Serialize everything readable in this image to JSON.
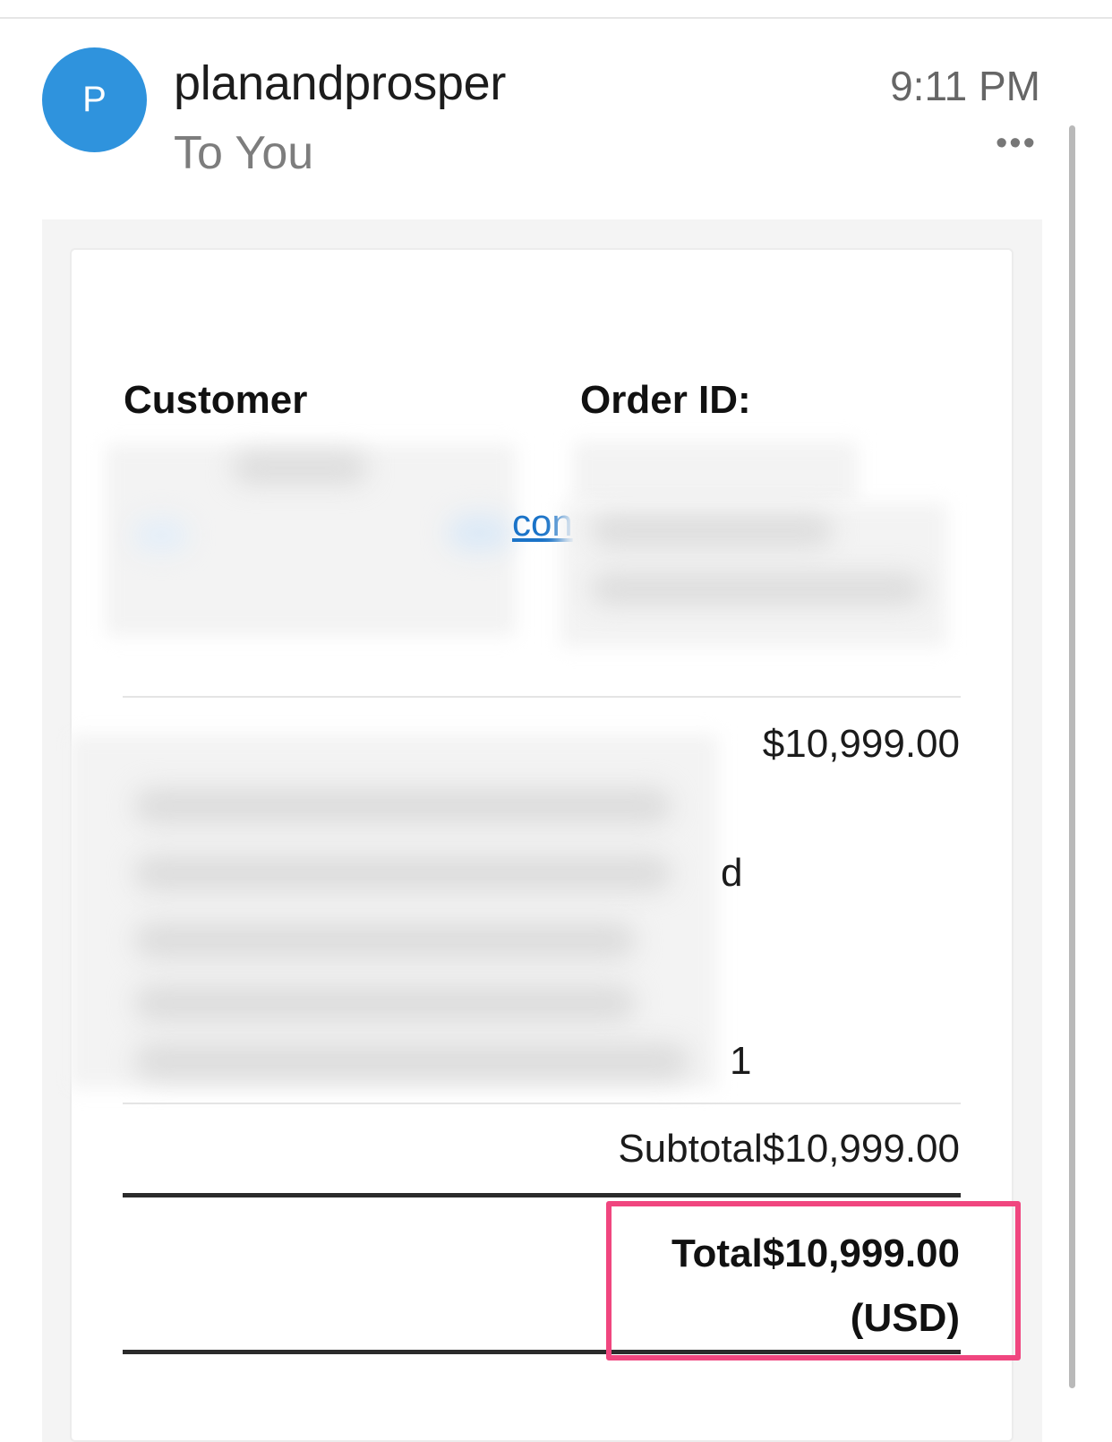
{
  "header": {
    "avatar_initial": "P",
    "sender": "planandprosper",
    "recipient": "To You",
    "time": "9:11 PM",
    "more_icon": "more-horizontal-icon"
  },
  "order": {
    "customer_label": "Customer",
    "order_id_label": "Order ID:",
    "link_fragment": "con",
    "item_fragment_d": "d",
    "item_quantity": "1",
    "item_price": "$10,999.00",
    "subtotal": "Subtotal$10,999.00",
    "total_line1": "Total$10,999.00",
    "total_line2": "(USD)"
  },
  "colors": {
    "avatar": "#2f93dd",
    "link": "#1a73c8",
    "highlight": "#f0467f"
  }
}
